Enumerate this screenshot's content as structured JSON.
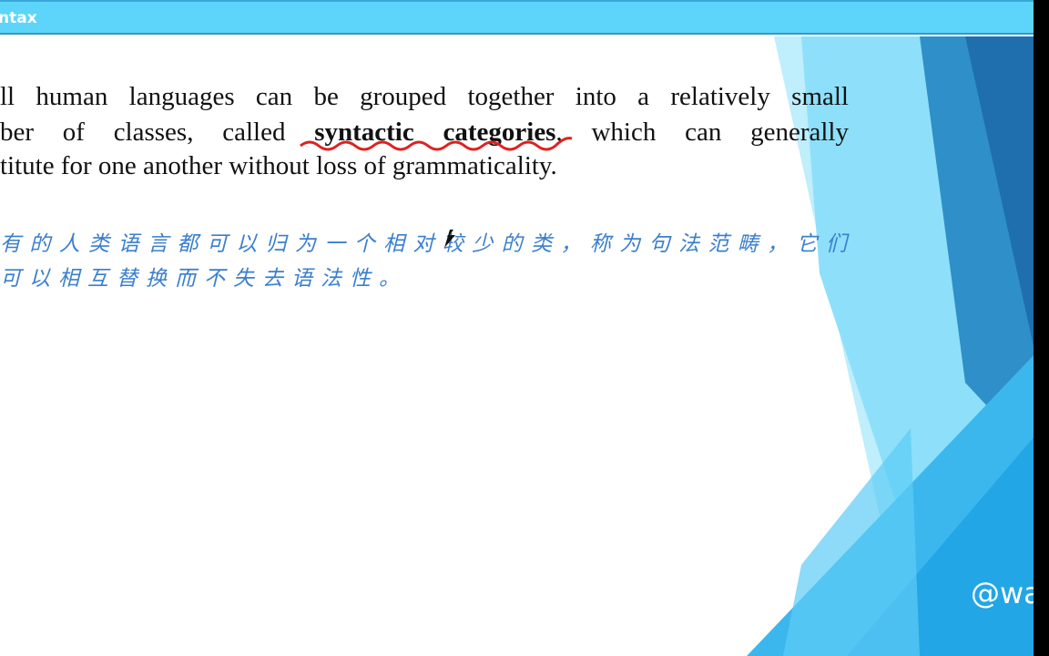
{
  "slide": {
    "title": "ntax",
    "english_lines": [
      {
        "pre": "ll human languages can be grouped together into a relatively small"
      },
      {
        "pre": "ber of classes, called ",
        "bold": "syntactic categories",
        "post": ", which can generally"
      },
      {
        "pre": "titute for one another without loss of grammaticality."
      }
    ],
    "chinese_lines": [
      "有的人类语言都可以归为一个相对较少的类，称为句法范畴，它们",
      "可以相互替换而不失去语法性。"
    ]
  },
  "watermark": "@wa",
  "colors": {
    "title_bar": "#5dd5fb",
    "chinese_text": "#3b7fcc",
    "annotation": "#e02020"
  }
}
